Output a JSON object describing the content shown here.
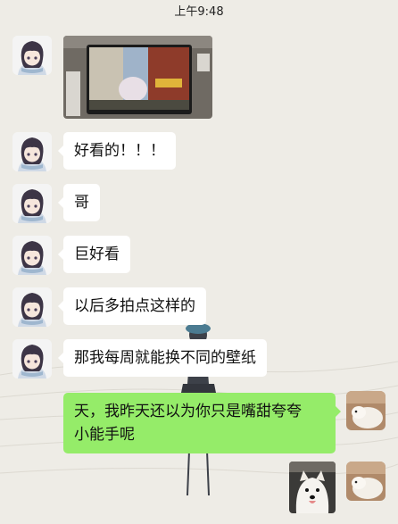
{
  "status_bar": {
    "time": "上午9:48"
  },
  "messages": [
    {
      "side": "left",
      "type": "image",
      "icon": "wallpaper-photo-thumbnail"
    },
    {
      "side": "left",
      "type": "text",
      "text": "好看的！！！"
    },
    {
      "side": "left",
      "type": "text",
      "text": "哥"
    },
    {
      "side": "left",
      "type": "text",
      "text": "巨好看"
    },
    {
      "side": "left",
      "type": "text",
      "text": "以后多拍点这样的"
    },
    {
      "side": "left",
      "type": "text",
      "text": "那我每周就能换不同的壁纸"
    },
    {
      "side": "right",
      "type": "text",
      "text_line1": "天，我昨天还以为你只是嘴甜夸夸",
      "text_line2": "小能手呢"
    },
    {
      "side": "right",
      "type": "image",
      "icon": "dog-photo-thumbnail"
    }
  ],
  "colors": {
    "chat_background": "#eeece6",
    "incoming_bubble": "#ffffff",
    "outgoing_bubble": "#95ec69"
  }
}
